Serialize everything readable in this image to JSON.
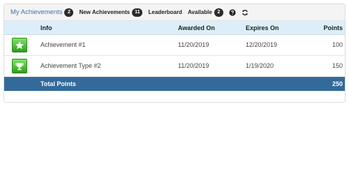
{
  "tabs": [
    {
      "label": "My Achievements",
      "badge": "2"
    },
    {
      "label": "New Achievements",
      "badge": "11"
    },
    {
      "label": "Leaderboard"
    },
    {
      "label": "Available",
      "badge": "2"
    }
  ],
  "toolbar_icons": [
    "help-icon",
    "refresh-icon"
  ],
  "table": {
    "columns": [
      "Info",
      "Awarded On",
      "Expires On",
      "Points"
    ],
    "rows": [
      {
        "icon": "star-icon",
        "info": "Achievement #1",
        "awarded_on": "11/20/2019",
        "expires_on": "12/20/2019",
        "points": "100"
      },
      {
        "icon": "trophy-icon",
        "info": "Achievement Type #2",
        "awarded_on": "11/20/2019",
        "expires_on": "1/19/2020",
        "points": "150"
      }
    ],
    "total_label": "Total Points",
    "total_value": "250"
  },
  "colors": {
    "active_tab": "#3a75b0",
    "header_bg": "#dceef9",
    "total_bg": "#336a9b",
    "badge_bg": "#2b2b2b",
    "icon_green": "#3fb52a"
  }
}
